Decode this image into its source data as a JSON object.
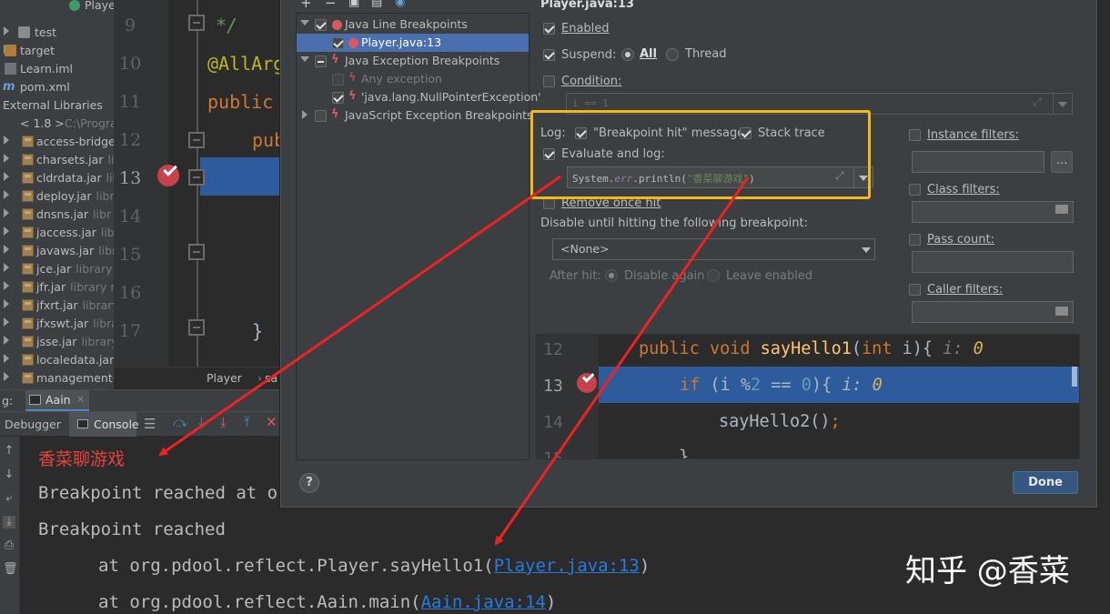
{
  "project_tree": {
    "items": [
      {
        "label": "Player",
        "kind": "class",
        "expanded": null
      },
      {
        "label": "test",
        "kind": "folder",
        "expanded": false
      },
      {
        "label": "target",
        "kind": "folder-orange",
        "expanded": false
      },
      {
        "label": "Learn.iml",
        "kind": "file",
        "expanded": null
      },
      {
        "label": "pom.xml",
        "kind": "maven",
        "expanded": null
      },
      {
        "label": "External Libraries",
        "kind": "libs",
        "expanded": true
      },
      {
        "label": "< 1.8 >",
        "hint": "C:\\Progra",
        "kind": "sdk",
        "expanded": true
      },
      {
        "label": "access-bridge-",
        "hint": "",
        "kind": "jar"
      },
      {
        "label": "charsets.jar",
        "hint": "lib",
        "kind": "jar"
      },
      {
        "label": "cldrdata.jar",
        "hint": "lib",
        "kind": "jar"
      },
      {
        "label": "deploy.jar",
        "hint": "libr",
        "kind": "jar"
      },
      {
        "label": "dnsns.jar",
        "hint": "libr",
        "kind": "jar"
      },
      {
        "label": "jaccess.jar",
        "hint": "lib",
        "kind": "jar"
      },
      {
        "label": "javaws.jar",
        "hint": "libr",
        "kind": "jar"
      },
      {
        "label": "jce.jar",
        "hint": "library r",
        "kind": "jar"
      },
      {
        "label": "jfr.jar",
        "hint": "library ro",
        "kind": "jar"
      },
      {
        "label": "jfxrt.jar",
        "hint": "library",
        "kind": "jar"
      },
      {
        "label": "jfxswt.jar",
        "hint": "librar",
        "kind": "jar"
      },
      {
        "label": "jsse.jar",
        "hint": "library",
        "kind": "jar"
      },
      {
        "label": "localedata.jar",
        "hint": "",
        "kind": "jar"
      },
      {
        "label": "management-a",
        "hint": "",
        "kind": "jar"
      }
    ]
  },
  "editor": {
    "lines": [
      {
        "num": "9",
        "code": "*/"
      },
      {
        "num": "10",
        "code": "@AllArg"
      },
      {
        "num": "11",
        "code": "public"
      },
      {
        "num": "12",
        "code": "pub"
      },
      {
        "num": "13",
        "code": ""
      },
      {
        "num": "14",
        "code": ""
      },
      {
        "num": "15",
        "code": ""
      },
      {
        "num": "16",
        "code": ""
      },
      {
        "num": "17",
        "code": "}"
      }
    ],
    "breadcrumb": "Player",
    "breadcrumb_tail": "sa"
  },
  "debug_panel": {
    "prefix": "g:",
    "run_tab": "Aain",
    "tabs": [
      "Debugger",
      "Console"
    ],
    "console_lines": [
      {
        "text": "香菜聊游戏",
        "color": "#e8413b"
      },
      {
        "text": "Breakpoint reached at or",
        "color": "#bbbbbb"
      },
      {
        "text": "Breakpoint reached",
        "color": "#bbbbbb"
      }
    ],
    "stack_lines": [
      {
        "prefix": "at org.pdool.reflect.Player.sayHello1(",
        "link": "Player.java:13",
        "suffix": ")"
      },
      {
        "prefix": "at org.pdool.reflect.Aain.main(",
        "link": "Aain.java:14",
        "suffix": ")"
      }
    ]
  },
  "dialog": {
    "header_title": "Player.java:13",
    "toolbar": [
      "+",
      "−",
      "▣",
      "▤",
      "◉"
    ],
    "tree": [
      {
        "label": "Java Line Breakpoints",
        "checked": "on",
        "icon": "dot",
        "indent": 0,
        "expanded": true,
        "selected": false,
        "disabled": false
      },
      {
        "label": "Player.java:13",
        "checked": "on",
        "icon": "dot-check",
        "indent": 1,
        "expanded": null,
        "selected": true,
        "disabled": false
      },
      {
        "label": "Java Exception Breakpoints",
        "checked": "mixed",
        "icon": "bolt",
        "indent": 0,
        "expanded": true,
        "selected": false,
        "disabled": false
      },
      {
        "label": "Any exception",
        "checked": "off",
        "icon": "bolt",
        "indent": 1,
        "expanded": null,
        "selected": false,
        "disabled": true
      },
      {
        "label": "'java.lang.NullPointerException'",
        "checked": "on",
        "icon": "bolt",
        "indent": 1,
        "expanded": null,
        "selected": false,
        "disabled": false
      },
      {
        "label": "JavaScript Exception Breakpoints",
        "checked": "off",
        "icon": "bolt",
        "indent": 0,
        "expanded": false,
        "selected": false,
        "disabled": false
      }
    ],
    "enabled_label": "Enabled",
    "suspend_label": "Suspend:",
    "suspend_all": "All",
    "suspend_thread": "Thread",
    "condition_label": "Condition:",
    "condition_value": "i == 1",
    "log_label": "Log:",
    "log_message_label": "\"Breakpoint hit\" message",
    "stack_trace_label": "Stack trace",
    "evaluate_label": "Evaluate and log:",
    "evaluate_value_prefix": "System.",
    "evaluate_value_err": "err",
    "evaluate_value_mid": ".println(",
    "evaluate_value_str": "\"香菜聊游戏\"",
    "evaluate_value_end": ")",
    "remove_once_hit": "Remove once hit",
    "disable_until": "Disable until hitting the following breakpoint:",
    "none_option": "<None>",
    "after_hit_label": "After hit:",
    "disable_again": "Disable again",
    "leave_enabled": "Leave enabled",
    "instance_filters": "Instance filters:",
    "class_filters": "Class filters:",
    "pass_count": "Pass count:",
    "caller_filters": "Caller filters:",
    "preview": [
      {
        "num": "12",
        "tokens": [
          [
            "public void ",
            "#cc7832"
          ],
          [
            "sayHello1",
            "#ffc66d"
          ],
          [
            "(",
            "#a9b7c6"
          ],
          [
            "int ",
            "#cc7832"
          ],
          [
            "i){",
            "#a9b7c6"
          ],
          [
            "  i: ",
            "#808080"
          ],
          [
            "0",
            "#d8b25a"
          ]
        ]
      },
      {
        "num": "13",
        "tokens": [
          [
            "if ",
            "#cc7832"
          ],
          [
            "(i %",
            "#a9b7c6"
          ],
          [
            "2",
            "#6897bb"
          ],
          [
            " == ",
            "#a9b7c6"
          ],
          [
            "0",
            "#6897bb"
          ],
          [
            "){",
            "#a9b7c6"
          ],
          [
            "  i: ",
            "#b0b8c8"
          ],
          [
            "0",
            "#d8b25a"
          ]
        ]
      },
      {
        "num": "14",
        "tokens": [
          [
            "sayHello2",
            "#a9b7c6"
          ],
          [
            "()",
            "#a9b7c6"
          ],
          [
            ";",
            "#cc7832"
          ]
        ]
      },
      {
        "num": "15",
        "tokens": [
          [
            "}",
            "#a9b7c6"
          ]
        ]
      }
    ],
    "done_label": "Done",
    "help_label": "?"
  },
  "watermark": "知乎 @香菜",
  "colors": {
    "accent": "#4b6eaf",
    "highlight_box": "#f3b91b",
    "arrow": "#ee2222",
    "breakpoint": "#db5860"
  }
}
